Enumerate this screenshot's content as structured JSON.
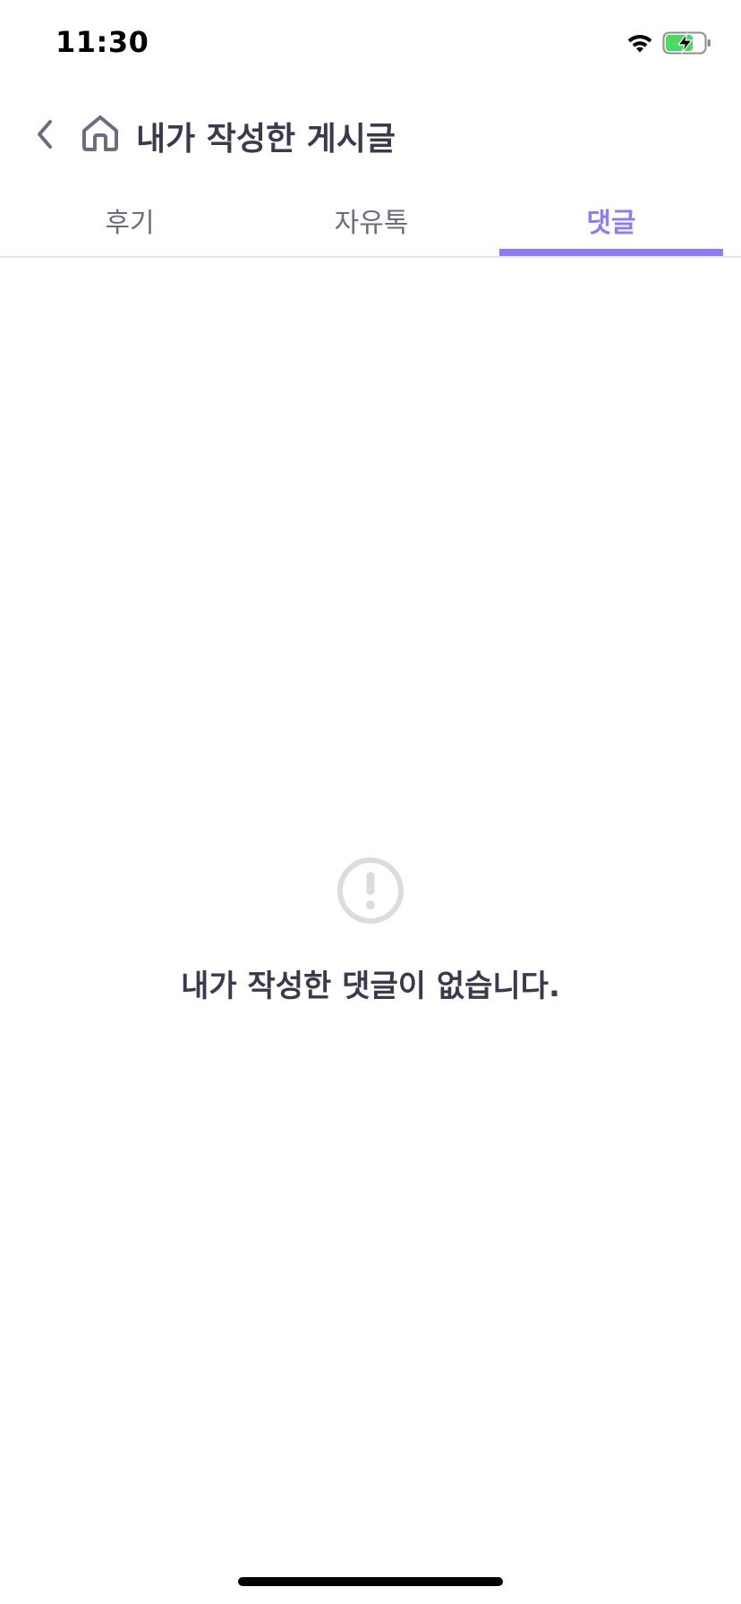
{
  "status_bar": {
    "time": "11:30",
    "wifi_icon": "wifi-icon",
    "battery_icon": "battery-charging-icon",
    "battery_color": "#4cd964"
  },
  "header": {
    "back_icon": "chevron-left-icon",
    "home_icon": "home-icon",
    "title": "내가 작성한 게시글"
  },
  "tabs": [
    {
      "label": "후기",
      "active": false
    },
    {
      "label": "자유톡",
      "active": false
    },
    {
      "label": "댓글",
      "active": true
    }
  ],
  "empty_state": {
    "icon": "exclamation-circle-icon",
    "message": "내가 작성한 댓글이 없습니다."
  },
  "colors": {
    "accent": "#8f7cf2",
    "text_primary": "#3b3a4d",
    "text_secondary": "#6c6b80",
    "icon_muted": "#dcdcdc"
  }
}
